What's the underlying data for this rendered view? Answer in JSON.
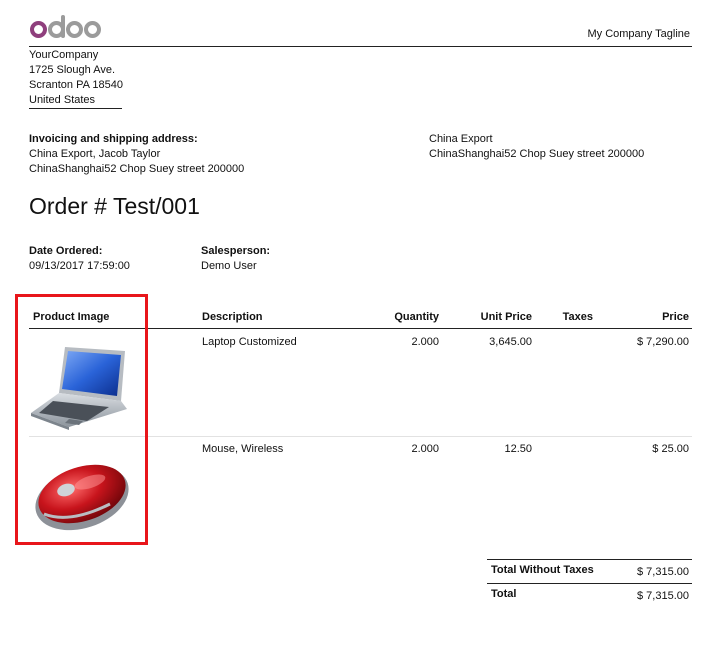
{
  "header": {
    "logo_text": "odoo",
    "tagline": "My Company Tagline"
  },
  "company": {
    "name": "YourCompany",
    "street": "1725 Slough Ave.",
    "city_line": "Scranton PA 18540",
    "country": "United States"
  },
  "addresses": {
    "invoicing_label": "Invoicing and shipping address:",
    "invoicing_name": "China Export, Jacob Taylor",
    "invoicing_street": "ChinaShanghai52 Chop Suey street 200000",
    "partner_name": "China Export",
    "partner_street": "ChinaShanghai52 Chop Suey street 200000"
  },
  "order": {
    "title": "Order # Test/001",
    "date_label": "Date Ordered:",
    "date_value": "09/13/2017 17:59:00",
    "salesperson_label": "Salesperson:",
    "salesperson_value": "Demo User"
  },
  "table": {
    "columns": [
      "Product Image",
      "Description",
      "Quantity",
      "Unit Price",
      "Taxes",
      "Price"
    ],
    "rows": [
      {
        "image": "laptop-image",
        "description": "Laptop Customized",
        "quantity": "2.000",
        "unit_price": "3,645.00",
        "taxes": "",
        "price": "$ 7,290.00"
      },
      {
        "image": "mouse-image",
        "description": "Mouse, Wireless",
        "quantity": "2.000",
        "unit_price": "12.50",
        "taxes": "",
        "price": "$ 25.00"
      }
    ]
  },
  "totals": {
    "without_taxes_label": "Total Without Taxes",
    "without_taxes_value": "$ 7,315.00",
    "total_label": "Total",
    "total_value": "$ 7,315.00"
  },
  "colors": {
    "logo_accent": "#8f3f7d",
    "logo_grey": "#9b9b9b",
    "highlight_box": "#e8161b"
  }
}
